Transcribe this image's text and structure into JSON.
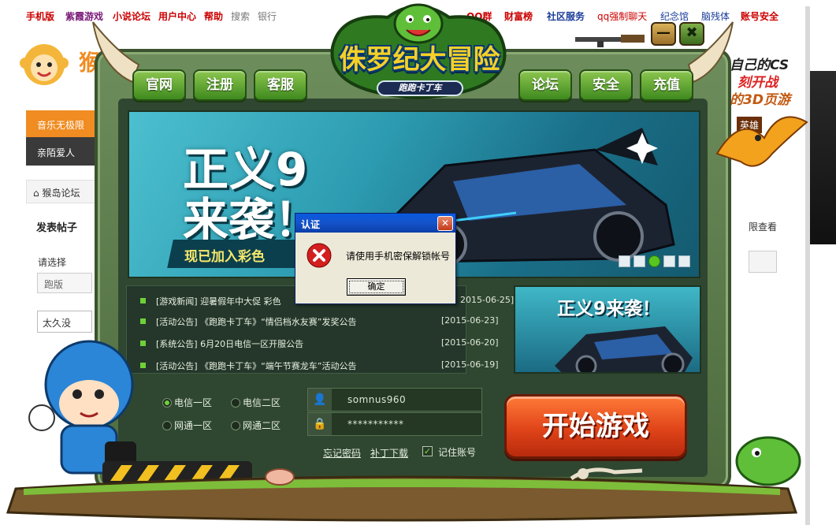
{
  "browser_page": {
    "nav_links": [
      {
        "label": "手机版",
        "style": "red"
      },
      {
        "label": "紫霞游戏",
        "style": "purple"
      },
      {
        "label": "小说论坛",
        "style": "red"
      },
      {
        "label": "用户中心",
        "style": "red"
      },
      {
        "label": "帮助",
        "style": "red"
      },
      {
        "label": "搜索",
        "style": "gray"
      },
      {
        "label": "银行",
        "style": "gray"
      },
      {
        "label": "QQ群",
        "style": "red"
      },
      {
        "label": "财富榜",
        "style": "red"
      },
      {
        "label": "社区服务",
        "style": "blue"
      },
      {
        "label": "qq强制聊天",
        "style": "red"
      },
      {
        "label": "纪念馆",
        "style": "blue"
      },
      {
        "label": "脑残体",
        "style": "blue"
      },
      {
        "label": "账号安全",
        "style": "red"
      }
    ],
    "left_logo_text": "猴",
    "music_tab": "音乐无极限",
    "sub_nav": "亲陌爱人",
    "breadcrumb": "猴岛论坛",
    "post_title": "发表帖子",
    "choose_label": "请选择",
    "select_value": "跑版",
    "input_value": "太久没",
    "right_ad_lines": [
      "自己的CS",
      "刻开战",
      "的3D页游"
    ],
    "right_login_text": "限查看",
    "right_hero_text": "英雄"
  },
  "launcher": {
    "logo_title": "侏罗纪大冒险",
    "logo_subtitle": "跑跑卡丁车",
    "minimize_label": "—",
    "close_label": "✖",
    "left_buttons": [
      "官网",
      "注册",
      "客服"
    ],
    "right_buttons": [
      "论坛",
      "安全",
      "充值"
    ],
    "banner": {
      "title_line1": "正义9",
      "title_line2": "来袭！",
      "subtitle": "现已加入彩色",
      "dots_count": 5,
      "active_dot": 2
    },
    "news": [
      {
        "text": "[游戏新闻] 迎暑假年中大促 彩色",
        "date": "2015-06-25]"
      },
      {
        "text": "[活动公告] 《跑跑卡丁车》“情侣档水友赛”发奖公告",
        "date": "[2015-06-23]"
      },
      {
        "text": "[系统公告] 6月20日电信一区开服公告",
        "date": "[2015-06-20]"
      },
      {
        "text": "[活动公告] 《跑跑卡丁车》“端午节赛龙车”活动公告",
        "date": "[2015-06-19]"
      }
    ],
    "side_banner_title": "正义9来袭！",
    "servers": [
      {
        "label": "电信一区",
        "selected": true
      },
      {
        "label": "电信二区",
        "selected": false
      },
      {
        "label": "网通一区",
        "selected": false
      },
      {
        "label": "网通二区",
        "selected": false
      }
    ],
    "username": "somnus960",
    "password_mask": "***********",
    "forgot_password": "忘记密码",
    "patch_download": "补丁下载",
    "remember_label": "记住账号",
    "remember_checked": true,
    "start_button": "开始游戏"
  },
  "dialog": {
    "title": "认证",
    "close_label": "✕",
    "message": "请使用手机密保解锁帐号",
    "ok_label": "确定"
  }
}
